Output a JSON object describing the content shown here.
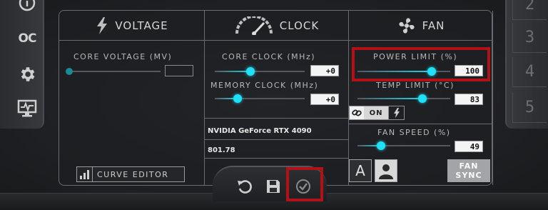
{
  "colors": {
    "accent": "#23dff5",
    "highlight": "#b01218",
    "panel_border": "#6a6b70"
  },
  "left_rail": {
    "items": [
      {
        "icon": "info-icon"
      },
      {
        "icon": "oc-scanner-icon",
        "text": "OC"
      },
      {
        "icon": "gear-icon"
      },
      {
        "icon": "monitor-icon"
      }
    ]
  },
  "right_rail": {
    "profiles": [
      "2",
      "3",
      "4",
      "5"
    ]
  },
  "voltage": {
    "title": "VOLTAGE",
    "core_voltage_label": "CORE VOLTAGE  (MV)",
    "core_voltage_value": "",
    "core_voltage_level": 0.0,
    "curve_editor_label": "CURVE EDITOR"
  },
  "clock": {
    "title": "CLOCK",
    "core_clock_label": "CORE CLOCK (MHz)",
    "core_clock_value": "+0",
    "core_clock_level": 0.4,
    "memory_clock_label": "MEMORY CLOCK (MHz)",
    "memory_clock_value": "+0",
    "memory_clock_level": 0.25,
    "gpu_name": "NVIDIA GeForce RTX 4090",
    "driver_version": "801.78"
  },
  "fan": {
    "title": "FAN",
    "power_limit_label": "POWER LIMIT (%)",
    "power_limit_value": "100",
    "power_limit_level": 0.8,
    "temp_limit_label": "TEMP LIMIT (°C)",
    "temp_limit_value": "83",
    "temp_limit_level": 0.7,
    "link_state": "ON",
    "fan_speed_label": "FAN SPEED (%)",
    "fan_speed_value": "49",
    "fan_speed_level": 0.25,
    "auto_label": "A",
    "fan_sync_line1": "FAN",
    "fan_sync_line2": "SYNC"
  },
  "actions": [
    "reset-icon",
    "save-icon",
    "apply-check-icon"
  ]
}
